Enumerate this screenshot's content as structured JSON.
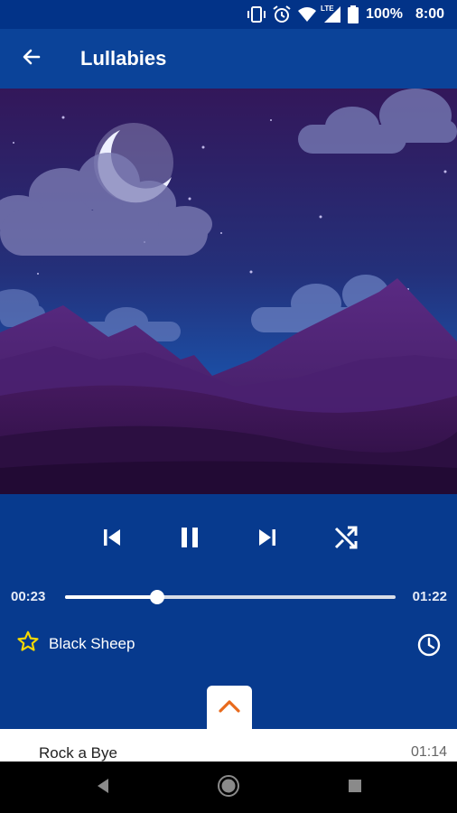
{
  "status_bar": {
    "battery": "100%",
    "time": "8:00",
    "network_label": "LTE",
    "icons": [
      "vibrate-icon",
      "alarm-icon",
      "wifi-icon",
      "signal-icon",
      "battery-icon"
    ]
  },
  "app_bar": {
    "title": "Lullabies",
    "back_icon": "arrow-back-icon"
  },
  "player": {
    "elapsed": "00:23",
    "duration": "01:22",
    "progress_fraction": 0.28,
    "current_song": "Black Sheep",
    "controls": [
      "skip-previous-icon",
      "pause-icon",
      "skip-next-icon",
      "shuffle-icon"
    ],
    "favorite_icon": "star-outline-icon",
    "timer_icon": "clock-icon"
  },
  "queue": {
    "expand_icon": "chevron-up-icon",
    "items": [
      {
        "title": "Rock a Bye",
        "duration": "01:14"
      }
    ]
  },
  "nav_bar": {
    "buttons": [
      "back-triangle-icon",
      "home-circle-icon",
      "recents-square-icon"
    ]
  },
  "colors": {
    "status_bar": "#023388",
    "app_bar": "#0b4399",
    "player_bg": "#073a8e",
    "star": "#f5d800",
    "chevron": "#e86a1c"
  }
}
